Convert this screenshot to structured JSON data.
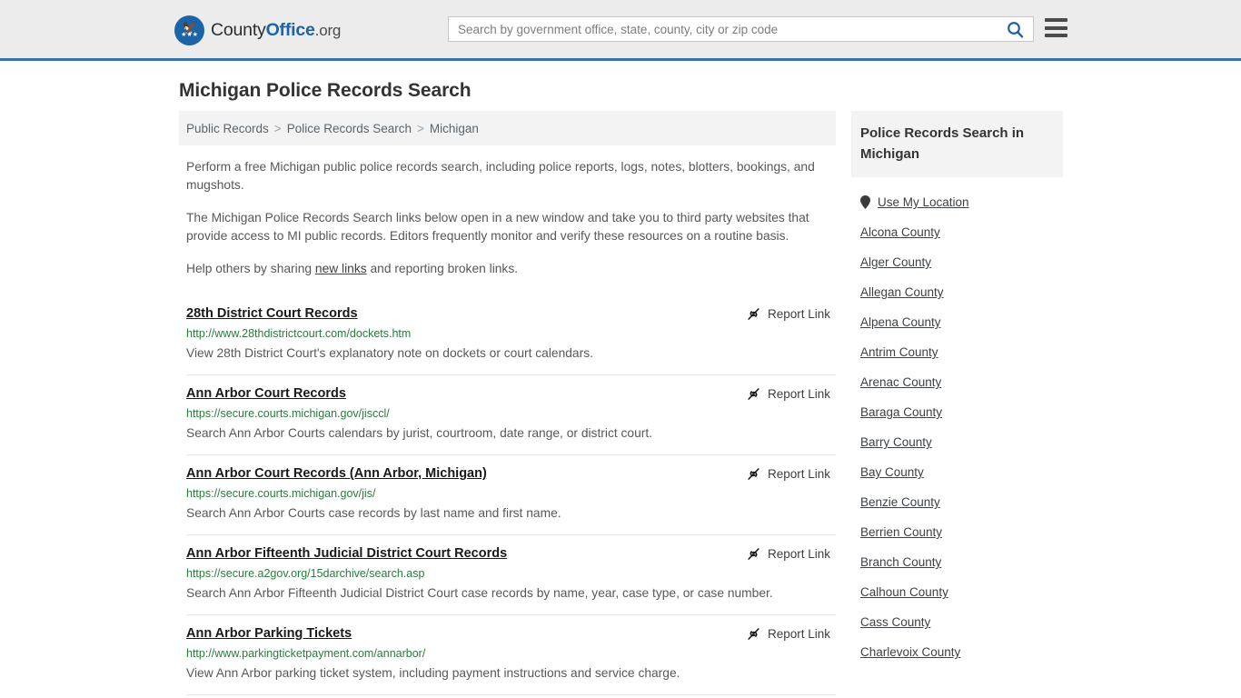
{
  "header": {
    "logo": {
      "part1": "County",
      "part2": "Office",
      "part3": ".org",
      "icon": "eagle-seal-icon"
    },
    "search": {
      "placeholder": "Search by government office, state, county, city or zip code",
      "value": "",
      "search_icon": "search-icon"
    },
    "menu_icon": "hamburger-menu-icon",
    "border_color": "#3a72a8",
    "background_color": "#ececec"
  },
  "page": {
    "title": "Michigan Police Records Search"
  },
  "breadcrumb": {
    "items": [
      {
        "label": "Public Records",
        "current": false
      },
      {
        "label": "Police Records Search",
        "current": false
      },
      {
        "label": "Michigan",
        "current": true
      }
    ],
    "separator": ">"
  },
  "intro": {
    "paragraph1": "Perform a free Michigan public police records search, including police reports, logs, notes, blotters, bookings, and mugshots.",
    "paragraph2": "The Michigan Police Records Search links below open in a new window and take you to third party websites that provide access to MI public records. Editors frequently monitor and verify these resources on a routine basis.",
    "paragraph3_pre": "Help others by sharing ",
    "paragraph3_link": "new links",
    "paragraph3_post": " and reporting broken links."
  },
  "results": {
    "report_label": "Report Link",
    "report_icon": "broken-link-icon",
    "items": [
      {
        "title": "28th District Court Records",
        "url": "http://www.28thdistrictcourt.com/dockets.htm",
        "description": "View 28th District Court's explanatory note on dockets or court calendars.",
        "report_label": "Report Link"
      },
      {
        "title": "Ann Arbor Court Records",
        "url": "https://secure.courts.michigan.gov/jisccl/",
        "description": "Search Ann Arbor Courts calendars by jurist, courtroom, date range, or district court.",
        "report_label": "Report Link"
      },
      {
        "title": "Ann Arbor Court Records (Ann Arbor, Michigan)",
        "url": "https://secure.courts.michigan.gov/jis/",
        "description": "Search Ann Arbor Courts case records by last name and first name.",
        "report_label": "Report Link"
      },
      {
        "title": "Ann Arbor Fifteenth Judicial District Court Records",
        "url": "https://secure.a2gov.org/15darchive/search.asp",
        "description": "Search Ann Arbor Fifteenth Judicial District Court case records by name, year, case type, or case number.",
        "report_label": "Report Link"
      },
      {
        "title": "Ann Arbor Parking Tickets",
        "url": "http://www.parkingticketpayment.com/annarbor/",
        "description": "View Ann Arbor parking ticket system, including payment instructions and service charge.",
        "report_label": "Report Link"
      }
    ]
  },
  "sidebar": {
    "heading": "Police Records Search in Michigan",
    "location_item": {
      "label": "Use My Location",
      "icon": "map-pin-icon"
    },
    "counties": [
      "Alcona County",
      "Alger County",
      "Allegan County",
      "Alpena County",
      "Antrim County",
      "Arenac County",
      "Baraga County",
      "Barry County",
      "Bay County",
      "Benzie County",
      "Berrien County",
      "Branch County",
      "Calhoun County",
      "Cass County",
      "Charlevoix County"
    ]
  },
  "colors": {
    "link_green": "#2d7a3e",
    "brand_blue": "#1c63a8",
    "text_gray": "#58585a"
  }
}
